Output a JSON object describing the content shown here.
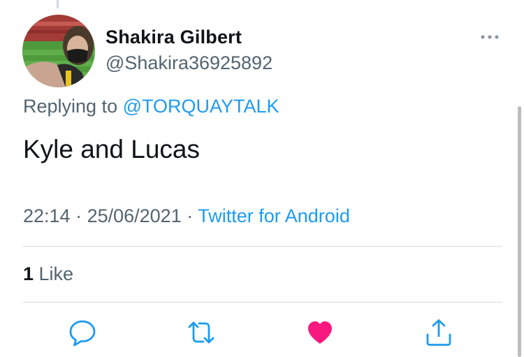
{
  "author": {
    "display_name": "Shakira Gilbert",
    "handle": "@Shakira36925892",
    "avatar_icon": "profile-photo"
  },
  "reply": {
    "prefix": "Replying to ",
    "mention": "@TORQUAYTALK"
  },
  "tweet": {
    "text": "Kyle and Lucas"
  },
  "meta": {
    "time": "22:14",
    "separator_1": " · ",
    "date": "25/06/2021",
    "separator_2": " · ",
    "source": "Twitter for Android"
  },
  "stats": {
    "like_count": "1",
    "like_label": " Like"
  },
  "actions": {
    "reply_icon": "reply-icon",
    "retweet_icon": "retweet-icon",
    "like_icon": "heart-icon",
    "share_icon": "share-icon",
    "like_active": true
  },
  "colors": {
    "accent": "#1d9bf0",
    "secondary_text": "#536471",
    "primary_text": "#0f1419",
    "like": "#f91880",
    "divider": "#d9d9d9"
  }
}
